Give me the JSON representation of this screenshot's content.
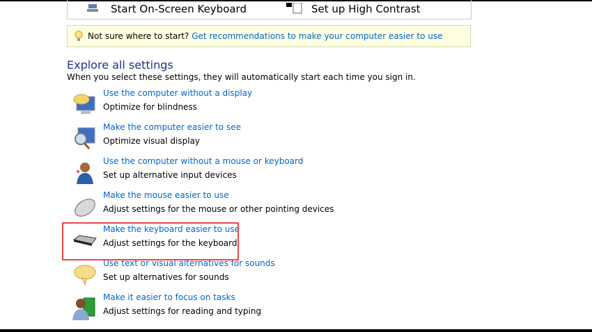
{
  "quick_access": {
    "on_screen_keyboard": "Start On-Screen Keyboard",
    "high_contrast": "Set up High Contrast"
  },
  "tip": {
    "prefix": "Not sure where to start?",
    "link": "Get recommendations to make your computer easier to use"
  },
  "explore": {
    "title": "Explore all settings",
    "subtitle": "When you select these settings, they will automatically start each time you sign in."
  },
  "items": [
    {
      "link": "Use the computer without a display",
      "desc": "Optimize for blindness",
      "icon": "monitor-speech-icon"
    },
    {
      "link": "Make the computer easier to see",
      "desc": "Optimize visual display",
      "icon": "monitor-magnifier-icon"
    },
    {
      "link": "Use the computer without a mouse or keyboard",
      "desc": "Set up alternative input devices",
      "icon": "person-headset-icon"
    },
    {
      "link": "Make the mouse easier to use",
      "desc": "Adjust settings for the mouse or other pointing devices",
      "icon": "mouse-icon"
    },
    {
      "link": "Make the keyboard easier to use",
      "desc": "Adjust settings for the keyboard",
      "icon": "keyboard-icon"
    },
    {
      "link": "Use text or visual alternatives for sounds",
      "desc": "Set up alternatives for sounds",
      "icon": "speech-bubble-icon"
    },
    {
      "link": "Make it easier to focus on tasks",
      "desc": "Adjust settings for reading and typing",
      "icon": "person-book-icon"
    }
  ],
  "colors": {
    "link": "#0066cc",
    "heading": "#1e3287",
    "highlight": "#e8474a",
    "tip_bg": "#ffffe1"
  }
}
